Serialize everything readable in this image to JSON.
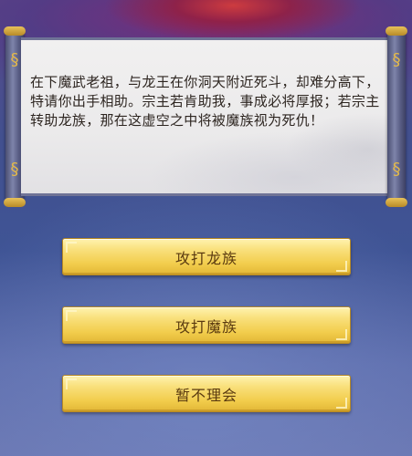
{
  "dialog": {
    "text": "在下魔武老祖，与龙王在你洞天附近死斗，却难分高下，特请你出手相助。宗主若肯助我，事成必将厚报；若宗主转助龙族，那在这虚空之中将被魔族视为死仇！"
  },
  "choices": [
    {
      "label": "攻打龙族"
    },
    {
      "label": "攻打魔族"
    },
    {
      "label": "暂不理会"
    }
  ],
  "colors": {
    "button_gold": "#f2cd4c",
    "button_text": "#5a3a10",
    "scroll_paper": "#ebeaeb",
    "scroll_rod": "#5a5f86"
  },
  "icons": [
    "scroll-rod-ornament-icon",
    "dragon-artwork"
  ]
}
